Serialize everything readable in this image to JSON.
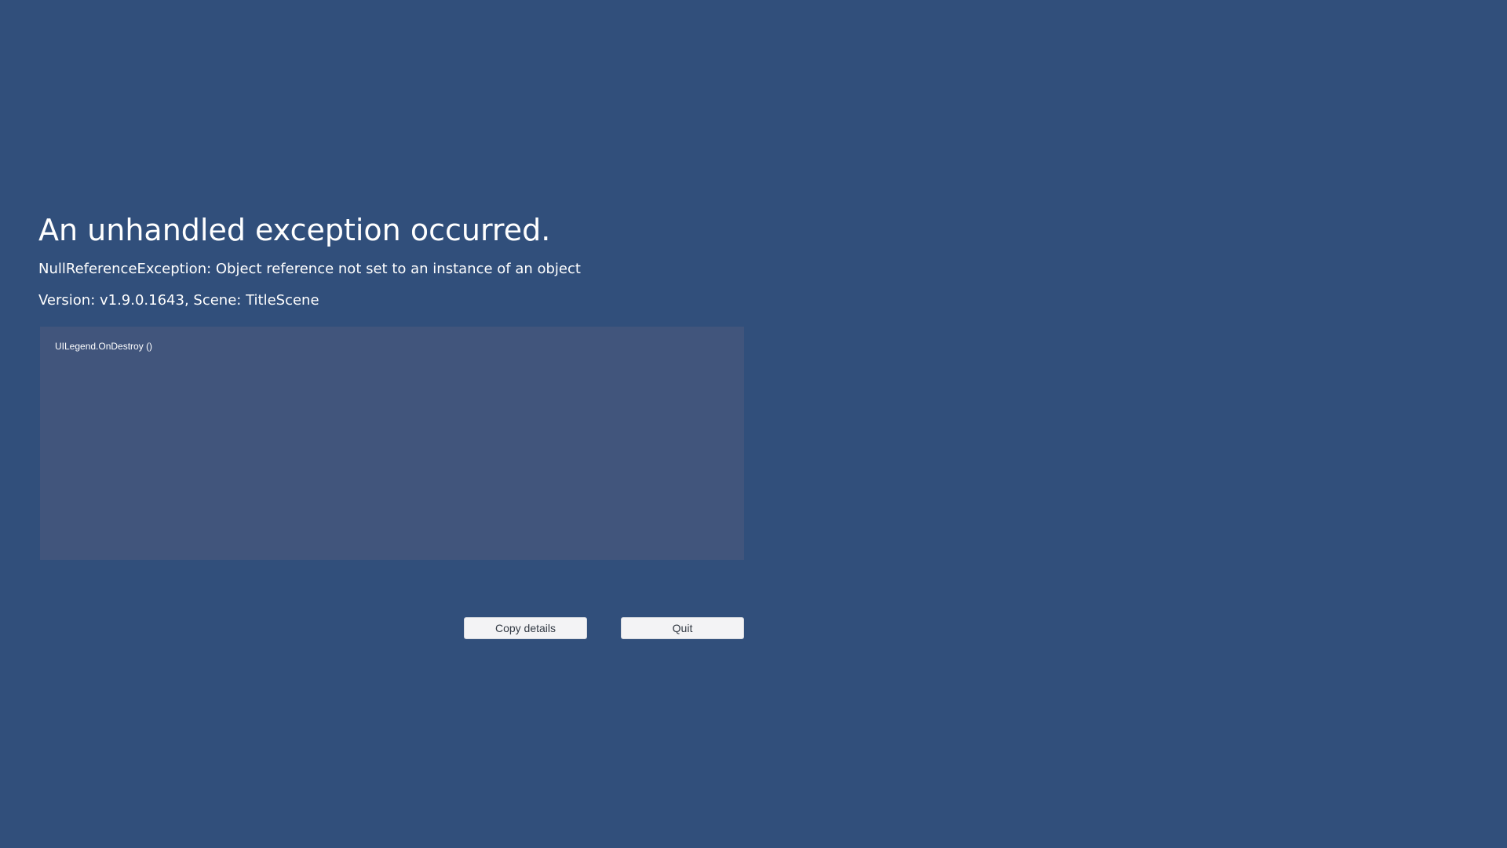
{
  "error": {
    "title": "An unhandled exception occurred.",
    "exception": "NullReferenceException: Object reference not set to an instance of an object",
    "version_line": "Version: v1.9.0.1643, Scene: TitleScene",
    "stack_trace": "UILegend.OnDestroy ()"
  },
  "buttons": {
    "copy_label": "Copy details",
    "quit_label": "Quit"
  },
  "colors": {
    "background": "#314f7b",
    "stack_box": "#41557c",
    "button_bg": "#f3f3f5",
    "text": "#ffffff"
  }
}
